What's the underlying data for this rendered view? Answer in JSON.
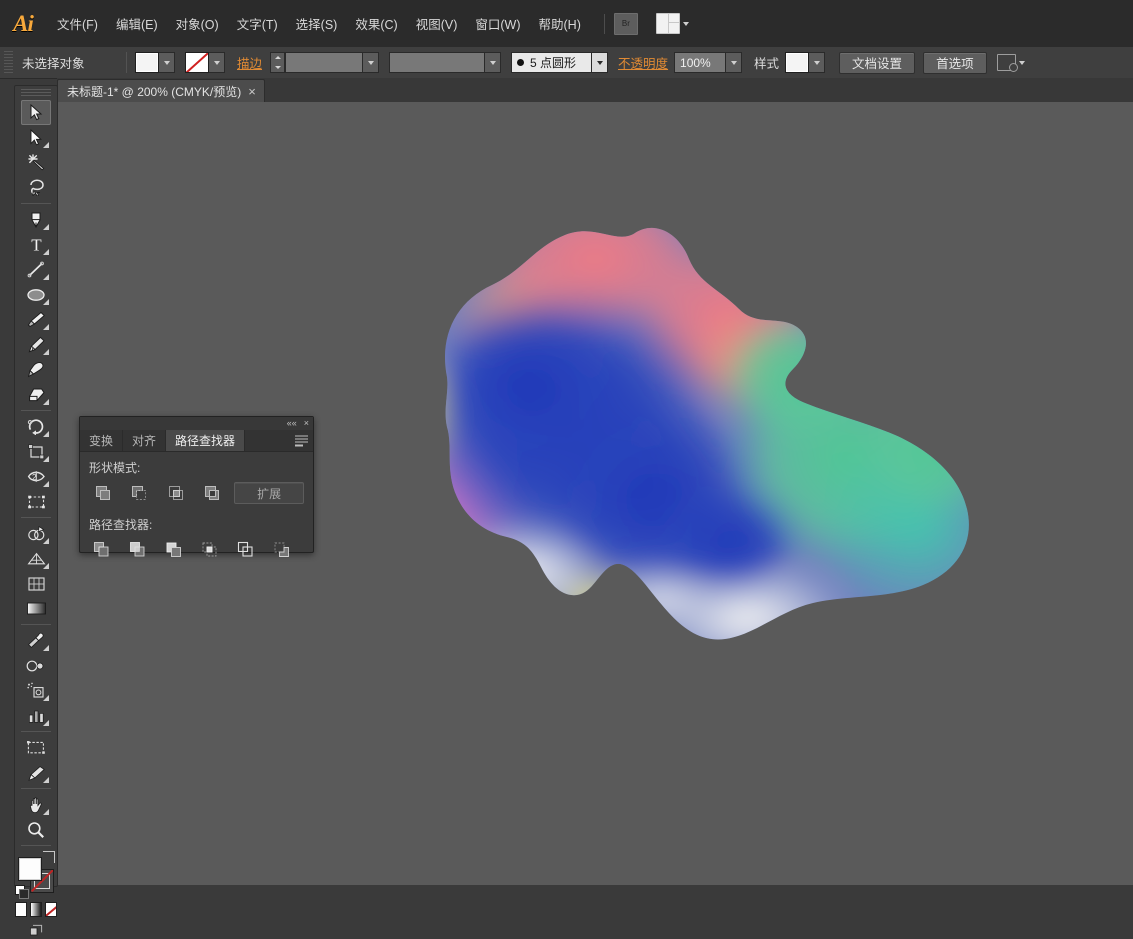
{
  "app": {
    "name": "Adobe Illustrator",
    "logo_text": "Ai"
  },
  "menubar": {
    "items": [
      {
        "label": "文件(F)",
        "name": "file"
      },
      {
        "label": "编辑(E)",
        "name": "edit"
      },
      {
        "label": "对象(O)",
        "name": "object"
      },
      {
        "label": "文字(T)",
        "name": "type"
      },
      {
        "label": "选择(S)",
        "name": "select"
      },
      {
        "label": "效果(C)",
        "name": "effect"
      },
      {
        "label": "视图(V)",
        "name": "view"
      },
      {
        "label": "窗口(W)",
        "name": "window"
      },
      {
        "label": "帮助(H)",
        "name": "help"
      }
    ],
    "bridge_button_label": "Br",
    "workspace_switcher_label": ""
  },
  "control_bar": {
    "selection_status": "未选择对象",
    "fill_swatch_color": "#f4f4f4",
    "stroke_swatch": "none",
    "stroke_label": "描边",
    "stroke_weight_value": "",
    "stroke_profile_value": "",
    "brush_definition_value": "5 点圆形",
    "opacity_label": "不透明度",
    "opacity_value": "100%",
    "style_label": "样式",
    "style_swatch_color": "#f0f0f0",
    "document_setup_label": "文档设置",
    "preferences_label": "首选项"
  },
  "document_tab": {
    "title": "未标题-1* @ 200% (CMYK/预览)",
    "close_label": "×"
  },
  "toolbar": {
    "tools": [
      {
        "name": "selection-tool",
        "label": "选择工具",
        "active": true,
        "has_flyout": false
      },
      {
        "name": "direct-selection-tool",
        "label": "直接选择工具",
        "active": false,
        "has_flyout": true
      },
      {
        "name": "magic-wand-tool",
        "label": "魔棒工具",
        "active": false,
        "has_flyout": false
      },
      {
        "name": "lasso-tool",
        "label": "套索工具",
        "active": false,
        "has_flyout": false
      },
      {
        "name": "pen-tool",
        "label": "钢笔工具",
        "active": false,
        "has_flyout": true
      },
      {
        "name": "type-tool",
        "label": "文字工具",
        "active": false,
        "has_flyout": true
      },
      {
        "name": "line-segment-tool",
        "label": "直线段工具",
        "active": false,
        "has_flyout": true
      },
      {
        "name": "ellipse-tool",
        "label": "椭圆工具",
        "active": false,
        "has_flyout": true
      },
      {
        "name": "paintbrush-tool",
        "label": "画笔工具",
        "active": false,
        "has_flyout": true
      },
      {
        "name": "pencil-tool",
        "label": "铅笔工具",
        "active": false,
        "has_flyout": true
      },
      {
        "name": "blob-brush-tool",
        "label": "斑点画笔工具",
        "active": false,
        "has_flyout": false
      },
      {
        "name": "eraser-tool",
        "label": "橡皮擦工具",
        "active": false,
        "has_flyout": true
      },
      {
        "name": "rotate-tool",
        "label": "旋转工具",
        "active": false,
        "has_flyout": true
      },
      {
        "name": "scale-tool",
        "label": "比例缩放工具",
        "active": false,
        "has_flyout": true
      },
      {
        "name": "width-tool",
        "label": "宽度工具",
        "active": false,
        "has_flyout": true
      },
      {
        "name": "free-transform-tool",
        "label": "自由变换工具",
        "active": false,
        "has_flyout": false
      },
      {
        "name": "shape-builder-tool",
        "label": "形状生成器工具",
        "active": false,
        "has_flyout": true
      },
      {
        "name": "perspective-grid-tool",
        "label": "透视网格工具",
        "active": false,
        "has_flyout": true
      },
      {
        "name": "mesh-tool",
        "label": "网格工具",
        "active": false,
        "has_flyout": false
      },
      {
        "name": "gradient-tool",
        "label": "渐变工具",
        "active": false,
        "has_flyout": false
      },
      {
        "name": "eyedropper-tool",
        "label": "吸管工具",
        "active": false,
        "has_flyout": true
      },
      {
        "name": "blend-tool",
        "label": "混合工具",
        "active": false,
        "has_flyout": false
      },
      {
        "name": "symbol-sprayer-tool",
        "label": "符号喷枪工具",
        "active": false,
        "has_flyout": true
      },
      {
        "name": "column-graph-tool",
        "label": "柱形图工具",
        "active": false,
        "has_flyout": true
      },
      {
        "name": "artboard-tool",
        "label": "画板工具",
        "active": false,
        "has_flyout": false
      },
      {
        "name": "slice-tool",
        "label": "切片工具",
        "active": false,
        "has_flyout": true
      },
      {
        "name": "hand-tool",
        "label": "抓手工具",
        "active": false,
        "has_flyout": true
      },
      {
        "name": "zoom-tool",
        "label": "缩放工具",
        "active": false,
        "has_flyout": false
      }
    ],
    "fill_color": "#fdfdfd",
    "stroke_color": "none",
    "color_mode_buttons": [
      {
        "name": "color-button",
        "label": "颜色"
      },
      {
        "name": "gradient-button",
        "label": "渐变"
      },
      {
        "name": "none-button",
        "label": "无"
      }
    ],
    "screen_mode_label": "更改屏幕模式"
  },
  "pathfinder_panel": {
    "collapse_label": "««",
    "close_label": "×",
    "tabs": [
      {
        "label": "变换",
        "name": "transform",
        "active": false
      },
      {
        "label": "对齐",
        "name": "align",
        "active": false
      },
      {
        "label": "路径查找器",
        "name": "pathfinder",
        "active": true
      }
    ],
    "shape_modes_label": "形状模式:",
    "shape_mode_buttons": [
      {
        "name": "unite-button",
        "label": "联集"
      },
      {
        "name": "minus-front-button",
        "label": "减去顶层"
      },
      {
        "name": "intersect-button",
        "label": "交集"
      },
      {
        "name": "exclude-button",
        "label": "差集"
      }
    ],
    "expand_label": "扩展",
    "pathfinders_label": "路径查找器:",
    "pathfinder_buttons": [
      {
        "name": "divide-button",
        "label": "分割"
      },
      {
        "name": "trim-button",
        "label": "修边"
      },
      {
        "name": "merge-button",
        "label": "合并"
      },
      {
        "name": "crop-button",
        "label": "裁剪"
      },
      {
        "name": "outline-button",
        "label": "轮廓"
      },
      {
        "name": "minus-back-button",
        "label": "减去后方对象"
      }
    ],
    "panel_menu_label": "面板菜单"
  },
  "canvas": {
    "background_color": "#5a5a5a",
    "artwork_name": "freeform-gradient-blob",
    "artwork_colors": {
      "blue": "#2a3fb0",
      "pink": "#e8707f",
      "salmon": "#ec8a7a",
      "green": "#63c896",
      "teal": "#55c9a6",
      "yellow": "#e8e070",
      "magenta": "#cc6ec0",
      "white": "#f7f5f2"
    }
  },
  "theme": {
    "chrome_dark": "#2b2b2b",
    "chrome_mid": "#3f3f3f",
    "panel_bg": "#3c3c3c",
    "canvas_bg": "#5a5a5a",
    "accent_orange": "#e08a34",
    "text": "#d4d4d4"
  }
}
